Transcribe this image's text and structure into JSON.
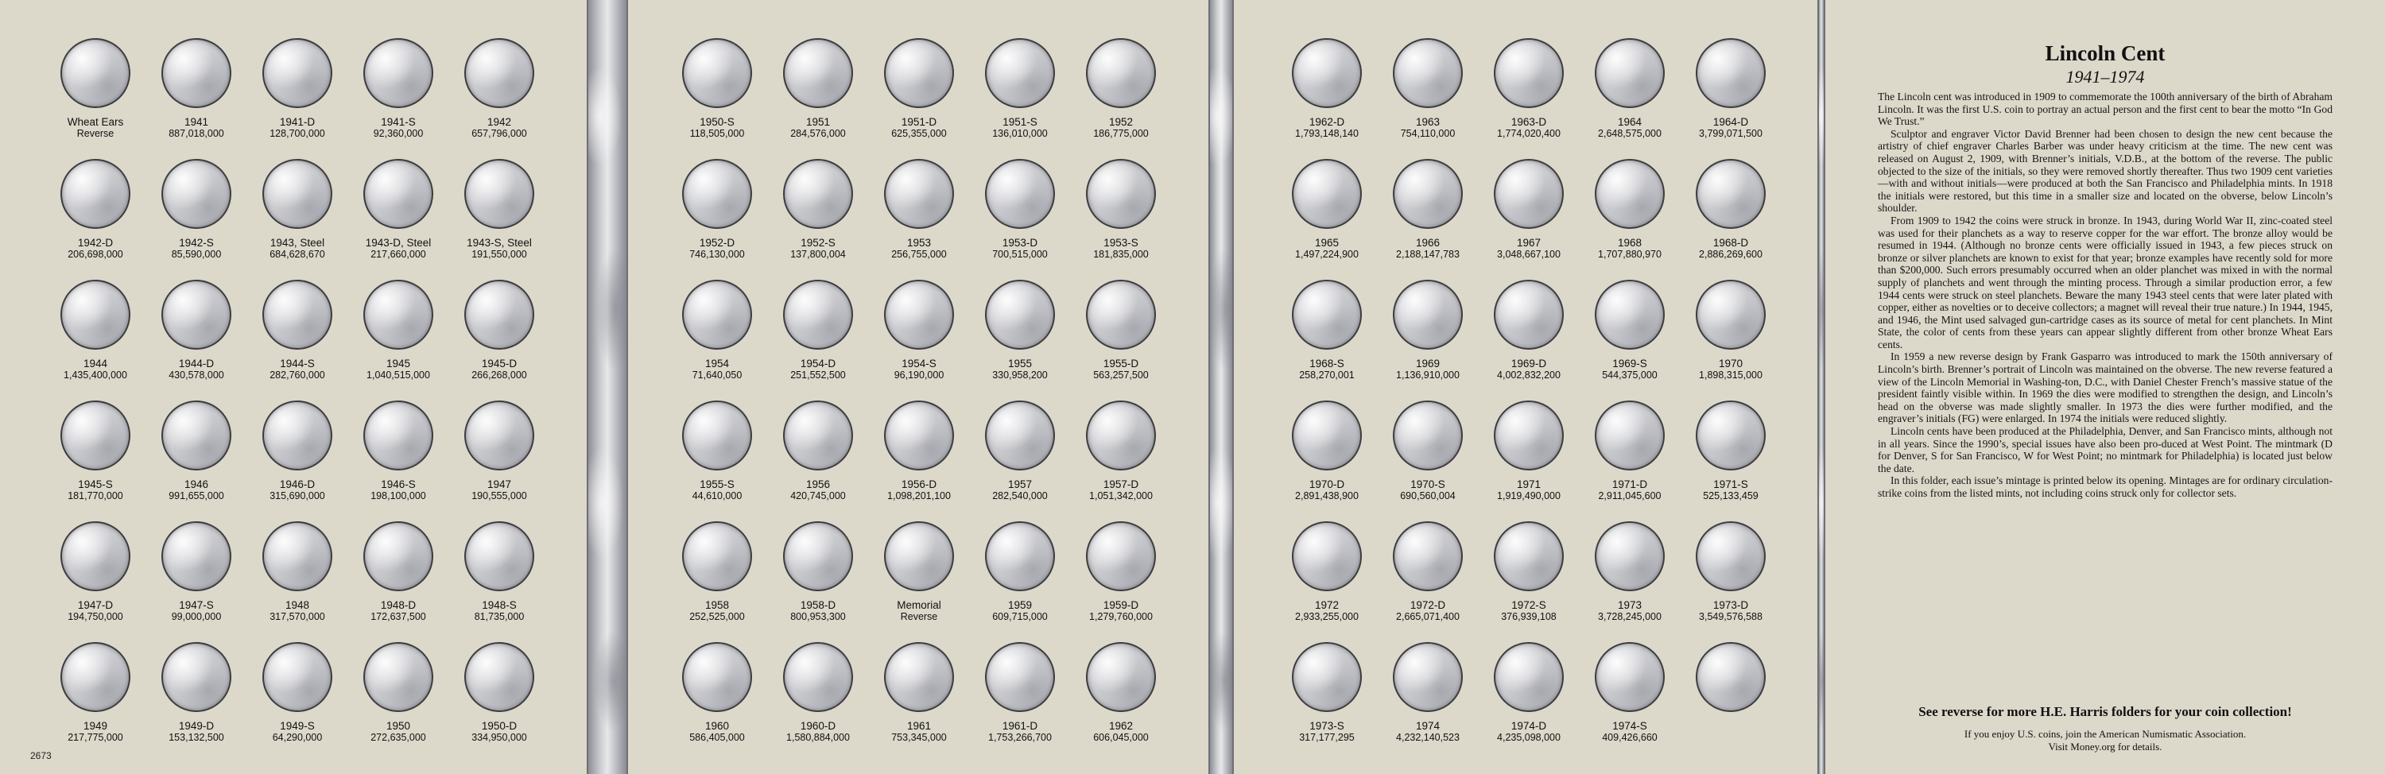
{
  "page_number": "2673",
  "pages": [
    {
      "coins": [
        {
          "label": "Wheat Ears",
          "mintage": "Reverse"
        },
        {
          "label": "1941",
          "mintage": "887,018,000"
        },
        {
          "label": "1941-D",
          "mintage": "128,700,000"
        },
        {
          "label": "1941-S",
          "mintage": "92,360,000"
        },
        {
          "label": "1942",
          "mintage": "657,796,000"
        },
        {
          "label": "1942-D",
          "mintage": "206,698,000"
        },
        {
          "label": "1942-S",
          "mintage": "85,590,000"
        },
        {
          "label": "1943, Steel",
          "mintage": "684,628,670"
        },
        {
          "label": "1943-D, Steel",
          "mintage": "217,660,000"
        },
        {
          "label": "1943-S, Steel",
          "mintage": "191,550,000"
        },
        {
          "label": "1944",
          "mintage": "1,435,400,000"
        },
        {
          "label": "1944-D",
          "mintage": "430,578,000"
        },
        {
          "label": "1944-S",
          "mintage": "282,760,000"
        },
        {
          "label": "1945",
          "mintage": "1,040,515,000"
        },
        {
          "label": "1945-D",
          "mintage": "266,268,000"
        },
        {
          "label": "1945-S",
          "mintage": "181,770,000"
        },
        {
          "label": "1946",
          "mintage": "991,655,000"
        },
        {
          "label": "1946-D",
          "mintage": "315,690,000"
        },
        {
          "label": "1946-S",
          "mintage": "198,100,000"
        },
        {
          "label": "1947",
          "mintage": "190,555,000"
        },
        {
          "label": "1947-D",
          "mintage": "194,750,000"
        },
        {
          "label": "1947-S",
          "mintage": "99,000,000"
        },
        {
          "label": "1948",
          "mintage": "317,570,000"
        },
        {
          "label": "1948-D",
          "mintage": "172,637,500"
        },
        {
          "label": "1948-S",
          "mintage": "81,735,000"
        },
        {
          "label": "1949",
          "mintage": "217,775,000"
        },
        {
          "label": "1949-D",
          "mintage": "153,132,500"
        },
        {
          "label": "1949-S",
          "mintage": "64,290,000"
        },
        {
          "label": "1950",
          "mintage": "272,635,000"
        },
        {
          "label": "1950-D",
          "mintage": "334,950,000"
        }
      ]
    },
    {
      "coins": [
        {
          "label": "1950-S",
          "mintage": "118,505,000"
        },
        {
          "label": "1951",
          "mintage": "284,576,000"
        },
        {
          "label": "1951-D",
          "mintage": "625,355,000"
        },
        {
          "label": "1951-S",
          "mintage": "136,010,000"
        },
        {
          "label": "1952",
          "mintage": "186,775,000"
        },
        {
          "label": "1952-D",
          "mintage": "746,130,000"
        },
        {
          "label": "1952-S",
          "mintage": "137,800,004"
        },
        {
          "label": "1953",
          "mintage": "256,755,000"
        },
        {
          "label": "1953-D",
          "mintage": "700,515,000"
        },
        {
          "label": "1953-S",
          "mintage": "181,835,000"
        },
        {
          "label": "1954",
          "mintage": "71,640,050"
        },
        {
          "label": "1954-D",
          "mintage": "251,552,500"
        },
        {
          "label": "1954-S",
          "mintage": "96,190,000"
        },
        {
          "label": "1955",
          "mintage": "330,958,200"
        },
        {
          "label": "1955-D",
          "mintage": "563,257,500"
        },
        {
          "label": "1955-S",
          "mintage": "44,610,000"
        },
        {
          "label": "1956",
          "mintage": "420,745,000"
        },
        {
          "label": "1956-D",
          "mintage": "1,098,201,100"
        },
        {
          "label": "1957",
          "mintage": "282,540,000"
        },
        {
          "label": "1957-D",
          "mintage": "1,051,342,000"
        },
        {
          "label": "1958",
          "mintage": "252,525,000"
        },
        {
          "label": "1958-D",
          "mintage": "800,953,300"
        },
        {
          "label": "Memorial",
          "mintage": "Reverse"
        },
        {
          "label": "1959",
          "mintage": "609,715,000"
        },
        {
          "label": "1959-D",
          "mintage": "1,279,760,000"
        },
        {
          "label": "1960",
          "mintage": "586,405,000"
        },
        {
          "label": "1960-D",
          "mintage": "1,580,884,000"
        },
        {
          "label": "1961",
          "mintage": "753,345,000"
        },
        {
          "label": "1961-D",
          "mintage": "1,753,266,700"
        },
        {
          "label": "1962",
          "mintage": "606,045,000"
        }
      ]
    },
    {
      "coins": [
        {
          "label": "1962-D",
          "mintage": "1,793,148,140"
        },
        {
          "label": "1963",
          "mintage": "754,110,000"
        },
        {
          "label": "1963-D",
          "mintage": "1,774,020,400"
        },
        {
          "label": "1964",
          "mintage": "2,648,575,000"
        },
        {
          "label": "1964-D",
          "mintage": "3,799,071,500"
        },
        {
          "label": "1965",
          "mintage": "1,497,224,900"
        },
        {
          "label": "1966",
          "mintage": "2,188,147,783"
        },
        {
          "label": "1967",
          "mintage": "3,048,667,100"
        },
        {
          "label": "1968",
          "mintage": "1,707,880,970"
        },
        {
          "label": "1968-D",
          "mintage": "2,886,269,600"
        },
        {
          "label": "1968-S",
          "mintage": "258,270,001"
        },
        {
          "label": "1969",
          "mintage": "1,136,910,000"
        },
        {
          "label": "1969-D",
          "mintage": "4,002,832,200"
        },
        {
          "label": "1969-S",
          "mintage": "544,375,000"
        },
        {
          "label": "1970",
          "mintage": "1,898,315,000"
        },
        {
          "label": "1970-D",
          "mintage": "2,891,438,900"
        },
        {
          "label": "1970-S",
          "mintage": "690,560,004"
        },
        {
          "label": "1971",
          "mintage": "1,919,490,000"
        },
        {
          "label": "1971-D",
          "mintage": "2,911,045,600"
        },
        {
          "label": "1971-S",
          "mintage": "525,133,459"
        },
        {
          "label": "1972",
          "mintage": "2,933,255,000"
        },
        {
          "label": "1972-D",
          "mintage": "2,665,071,400"
        },
        {
          "label": "1972-S",
          "mintage": "376,939,108"
        },
        {
          "label": "1973",
          "mintage": "3,728,245,000"
        },
        {
          "label": "1973-D",
          "mintage": "3,549,576,588"
        },
        {
          "label": "1973-S",
          "mintage": "317,177,295"
        },
        {
          "label": "1974",
          "mintage": "4,232,140,523"
        },
        {
          "label": "1974-D",
          "mintage": "4,235,098,000"
        },
        {
          "label": "1974-S",
          "mintage": "409,426,660"
        },
        {
          "label": "",
          "mintage": ""
        }
      ]
    }
  ],
  "info": {
    "title": "Lincoln Cent",
    "subtitle": "1941–1974",
    "paragraphs": [
      "The Lincoln cent was introduced in 1909 to commemorate the 100th anniversary of the birth of Abraham Lincoln. It was the first U.S. coin to portray an actual person and the first cent to bear the motto “In God We Trust.”",
      "Sculptor and engraver Victor David Brenner had been chosen to design the new cent because the artistry of chief engraver Charles Barber was under heavy criticism at the time. The new cent was released on August 2, 1909, with Brenner’s initials, V.D.B., at the bottom of the reverse. The public objected to the size of the initials, so they were removed shortly thereafter. Thus two 1909 cent varieties—with and without initials—were produced at both the San Francisco and Philadelphia mints. In 1918 the initials were restored, but this time in a smaller size and located on the obverse, below Lincoln’s shoulder.",
      "From 1909 to 1942 the coins were struck in bronze. In 1943, during World War II, zinc-coated steel was used for their planchets as a way to reserve copper for the war effort. The bronze alloy would be resumed in 1944. (Although no bronze cents were officially issued in 1943, a few pieces struck on bronze or silver planchets are known to exist for that year; bronze examples have recently sold for more than $200,000. Such errors presumably occurred when an older planchet was mixed in with the normal supply of planchets and went through the minting process. Through a similar production error, a few 1944 cents were struck on steel planchets. Beware the many 1943 steel cents that were later plated with copper, either as novelties or to deceive collectors; a magnet will reveal their true nature.) In 1944, 1945, and 1946, the Mint used salvaged gun-cartridge cases as its source of metal for cent planchets. In Mint State, the color of cents from these years can appear slightly different from other bronze Wheat Ears cents.",
      "In 1959 a new reverse design by Frank Gasparro was introduced to mark the 150th anniversary of Lincoln’s birth. Brenner’s portrait of Lincoln was maintained on the obverse. The new reverse featured a view of the Lincoln Memorial in Washing-ton, D.C., with Daniel Chester French’s massive statue of the president faintly visible within. In 1969 the dies were modified to strengthen the design, and Lincoln’s head on the obverse was made slightly smaller. In 1973 the dies were further modified, and the engraver’s initials (FG) were enlarged. In 1974 the initials were reduced slightly.",
      "Lincoln cents have been produced at the Philadelphia, Denver, and San Francisco mints, although not in all years. Since the 1990’s, special issues have also been pro-duced at West Point. The mintmark (D for Denver, S for San Francisco, W for West Point; no mintmark for Philadelphia) is located just below the date.",
      "In this folder, each issue’s mintage is printed below its opening. Mintages are for ordinary circulation-strike coins from the listed mints, not including coins struck only for collector sets."
    ],
    "promo": "See reverse for more H.E. Harris folders for your coin collection!",
    "footer_line1": "If you enjoy U.S. coins, join the American Numismatic Association.",
    "footer_line2": "Visit Money.org for details."
  }
}
